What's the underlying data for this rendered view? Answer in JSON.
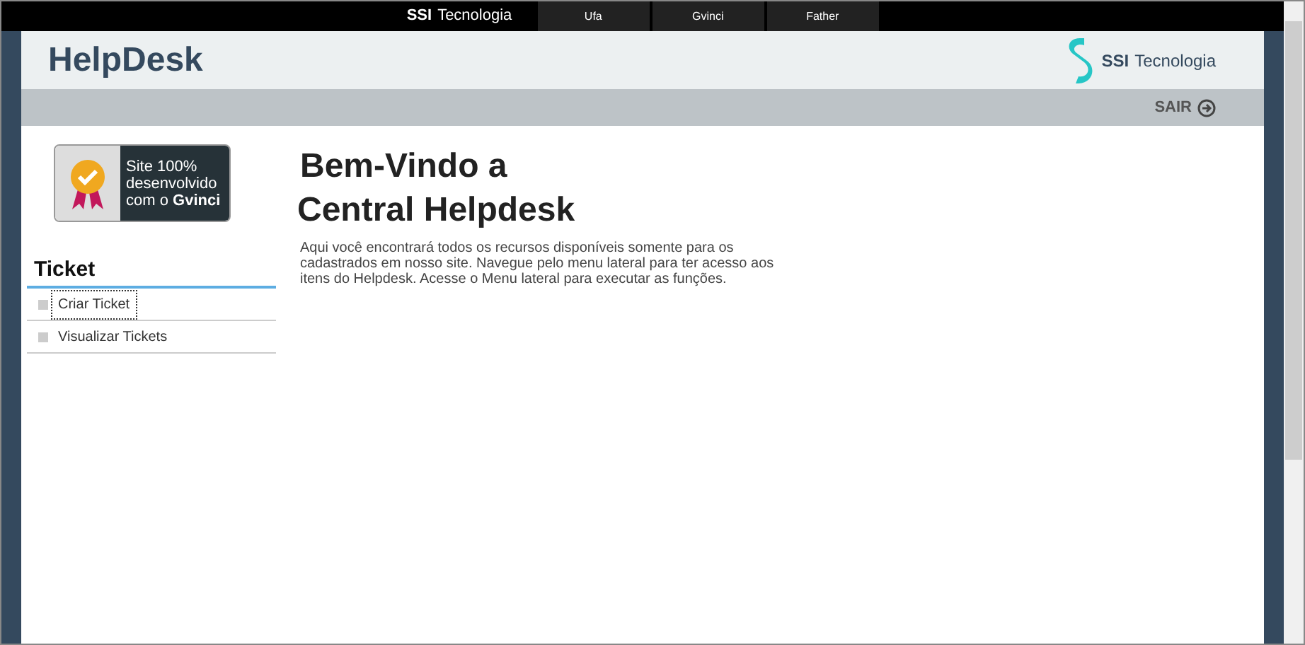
{
  "top_bar": {
    "brand_bold": "SSI",
    "brand_light": "Tecnologia",
    "tabs": [
      {
        "label": "Ufa"
      },
      {
        "label": "Gvinci"
      },
      {
        "label": "Father"
      }
    ]
  },
  "header": {
    "title": "HelpDesk",
    "logo_bold": "SSI",
    "logo_light": "Tecnologia"
  },
  "sub_bar": {
    "logout": "SAIR"
  },
  "badge": {
    "text": "Site 100% desenvolvido com o **Gvinci**"
  },
  "sidebar": {
    "heading": "Ticket",
    "items": [
      {
        "label": "Criar Ticket",
        "selected": true
      },
      {
        "label": "Visualizar Tickets",
        "selected": false
      }
    ]
  },
  "main": {
    "title_line_1": "Bem-Vindo a",
    "title_line_2": "Central Helpdesk",
    "text": "Aqui você encontrará todos os recursos disponíveis somente para os cadastrados em nosso site. Navegue pelo menu lateral para ter acesso aos itens do Helpdesk. Acesse o Menu lateral para executar as funções."
  }
}
